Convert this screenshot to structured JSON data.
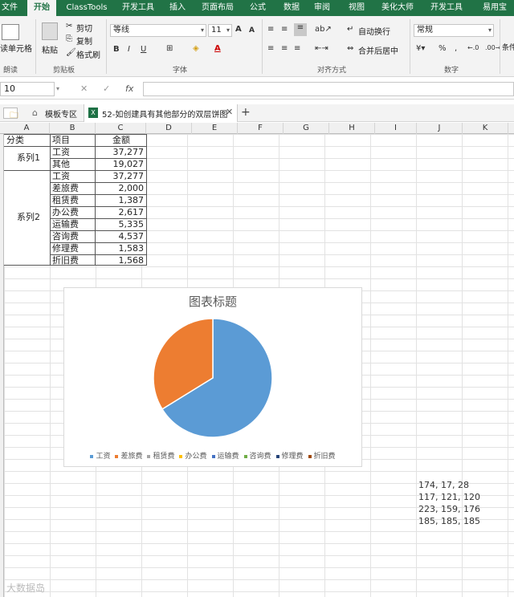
{
  "ribbon_tabs": [
    "文件",
    "开始",
    "ClassTools",
    "开发工具",
    "插入",
    "页面布局",
    "公式",
    "数据",
    "审阅",
    "视图",
    "美化大师",
    "开发工具",
    "易用宝"
  ],
  "active_tab": "开始",
  "ribbon": {
    "merge_cells": "读单元格",
    "paste": "粘贴",
    "cut": "剪切",
    "copy": "复制",
    "format_painter": "格式刷",
    "clipboard_group": "剪贴板",
    "font_group": "字体",
    "align_group": "对齐方式",
    "number_group": "数字",
    "read_group": "朗读",
    "font_name": "等线",
    "font_size": "11",
    "bold": "B",
    "italic": "I",
    "underline": "U",
    "wrap_text": "自动换行",
    "merge_center": "合并后居中",
    "number_format": "常规",
    "percent": "%",
    "comma": ",",
    "font_a_grow": "A",
    "font_a_shrink": "A",
    "font_color_a": "A",
    "right_group_stub": "条件"
  },
  "formula_bar": {
    "name_box": "10",
    "cancel": "✕",
    "enter": "✓",
    "fx": "fx"
  },
  "doc_tabs": {
    "templates": "模板专区",
    "file": "52-如创建具有其他部分的双层饼图",
    "add": "+"
  },
  "columns": [
    "A",
    "B",
    "C",
    "D",
    "E",
    "F",
    "G",
    "H",
    "I",
    "J",
    "K"
  ],
  "table": {
    "headers": {
      "a": "分类",
      "b": "项目",
      "c": "金额"
    },
    "groups": [
      "系列1",
      "系列2"
    ],
    "rows": [
      {
        "item": "工资",
        "amount": "37,277"
      },
      {
        "item": "其他",
        "amount": "19,027"
      },
      {
        "item": "工资",
        "amount": "37,277"
      },
      {
        "item": "差旅费",
        "amount": "2,000"
      },
      {
        "item": "租赁费",
        "amount": "1,387"
      },
      {
        "item": "办公费",
        "amount": "2,617"
      },
      {
        "item": "运输费",
        "amount": "5,335"
      },
      {
        "item": "咨询费",
        "amount": "4,537"
      },
      {
        "item": "修理费",
        "amount": "1,583"
      },
      {
        "item": "折旧费",
        "amount": "1,568"
      }
    ]
  },
  "chart_data": {
    "type": "pie",
    "title": "图表标题",
    "categories": [
      "工资",
      "其他"
    ],
    "values": [
      37277,
      19027
    ],
    "colors": [
      "#5b9bd5",
      "#ed7d31"
    ],
    "legend": [
      "工资",
      "差旅费",
      "租赁费",
      "办公费",
      "运输费",
      "咨询费",
      "修理费",
      "折旧费"
    ],
    "legend_colors": [
      "#5b9bd5",
      "#ed7d31",
      "#a5a5a5",
      "#ffc000",
      "#4472c4",
      "#70ad47",
      "#264478",
      "#9e480e"
    ],
    "legend_position": "bottom"
  },
  "notes": [
    "174, 17, 28",
    "117, 121, 120",
    "223, 159, 176",
    "185, 185, 185"
  ],
  "watermark": "大数据岛"
}
